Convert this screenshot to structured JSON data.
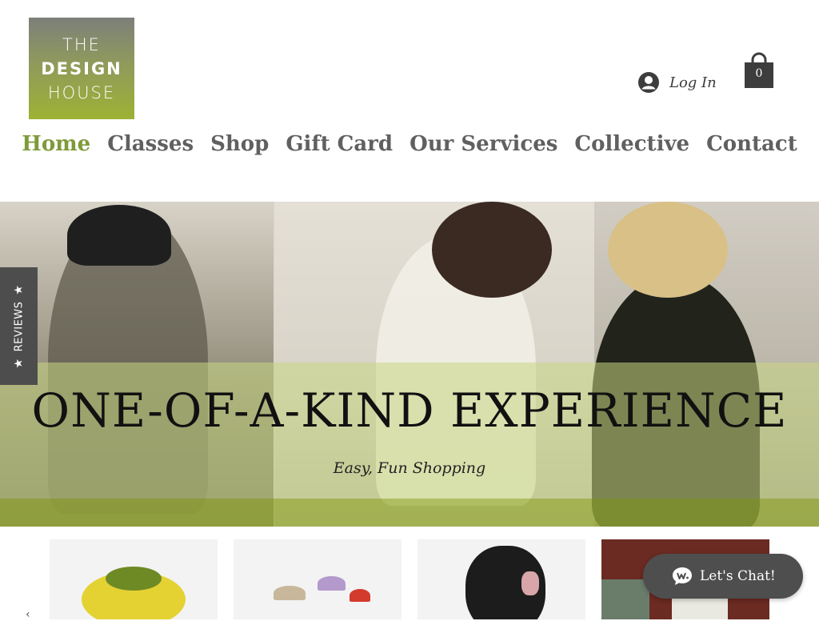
{
  "logo": {
    "line1": "THE",
    "line2": "DESIGN",
    "line3": "HOUSE"
  },
  "header": {
    "login_label": "Log In",
    "cart_count": "0"
  },
  "nav": {
    "items": [
      {
        "label": "Home",
        "active": true
      },
      {
        "label": "Classes"
      },
      {
        "label": "Shop"
      },
      {
        "label": "Gift Card"
      },
      {
        "label": "Our Services"
      },
      {
        "label": "Collective"
      },
      {
        "label": "Contact"
      }
    ]
  },
  "hero": {
    "headline": "ONE-OF-A-KIND EXPERIENCE",
    "subheadline": "Easy, Fun Shopping"
  },
  "reviews_tab": {
    "label": "REVIEWS",
    "star": "★"
  },
  "products": [
    {
      "icon": "pumpkins-image"
    },
    {
      "icon": "mushrooms-image"
    },
    {
      "icon": "felted-creature-image"
    },
    {
      "icon": "craft-image"
    }
  ],
  "carousel": {
    "prev_arrow": "‹"
  },
  "chat": {
    "label": "Let's Chat!"
  },
  "colors": {
    "accent": "#7f9a3a",
    "nav_text": "#606060",
    "dark": "#4d4d4d"
  }
}
